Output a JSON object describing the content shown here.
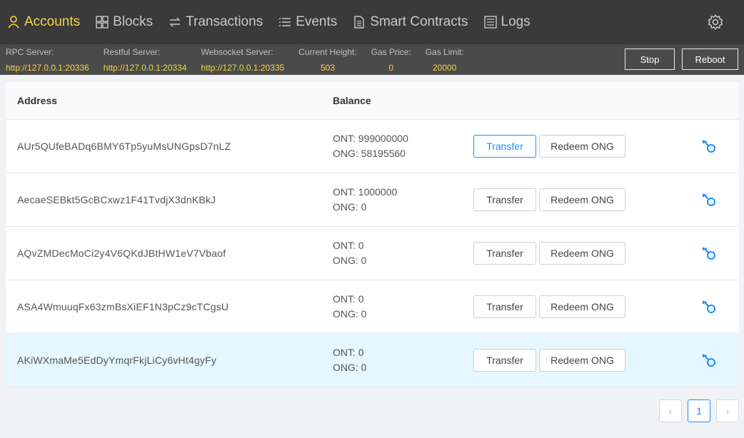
{
  "nav": {
    "items": [
      {
        "label": "Accounts",
        "icon": "user-icon",
        "active": true
      },
      {
        "label": "Blocks",
        "icon": "grid-icon"
      },
      {
        "label": "Transactions",
        "icon": "swap-icon"
      },
      {
        "label": "Events",
        "icon": "list-icon"
      },
      {
        "label": "Smart Contracts",
        "icon": "file-icon"
      },
      {
        "label": "Logs",
        "icon": "log-icon"
      }
    ],
    "settings_icon": "gear-icon"
  },
  "status": {
    "rpc_label": "RPC Server:",
    "rpc_value": "http://127.0.0.1:20336",
    "restful_label": "Restful Server:",
    "restful_value": "http://127.0.0.1:20334",
    "ws_label": "Websocket Server:",
    "ws_value": "http://127.0.0.1:20335",
    "height_label": "Current Height:",
    "height_value": "503",
    "gasprice_label": "Gas Price:",
    "gasprice_value": "0",
    "gaslimit_label": "Gas Limit:",
    "gaslimit_value": "20000",
    "stop_label": "Stop",
    "reboot_label": "Reboot"
  },
  "table": {
    "col_address": "Address",
    "col_balance": "Balance",
    "transfer_label": "Transfer",
    "redeem_label": "Redeem ONG",
    "rows": [
      {
        "address": "AUr5QUfeBADq6BMY6Tp5yuMsUNGpsD7nLZ",
        "ont": "ONT: 999000000",
        "ong": "ONG: 58195560"
      },
      {
        "address": "AecaeSEBkt5GcBCxwz1F41TvdjX3dnKBkJ",
        "ont": "ONT: 1000000",
        "ong": "ONG: 0"
      },
      {
        "address": "AQvZMDecMoCi2y4V6QKdJBtHW1eV7Vbaof",
        "ont": "ONT: 0",
        "ong": "ONG: 0"
      },
      {
        "address": "ASA4WmuuqFx63zmBsXiEF1N3pCz9cTCgsU",
        "ont": "ONT: 0",
        "ong": "ONG: 0"
      },
      {
        "address": "AKiWXmaMe5EdDyYmqrFkjLiCy6vHt4gyFy",
        "ont": "ONT: 0",
        "ong": "ONG: 0"
      }
    ]
  },
  "pagination": {
    "current": "1"
  },
  "colors": {
    "accent": "#f5d547",
    "primary": "#1890ff",
    "highlight_row": "#e6f7ff"
  }
}
